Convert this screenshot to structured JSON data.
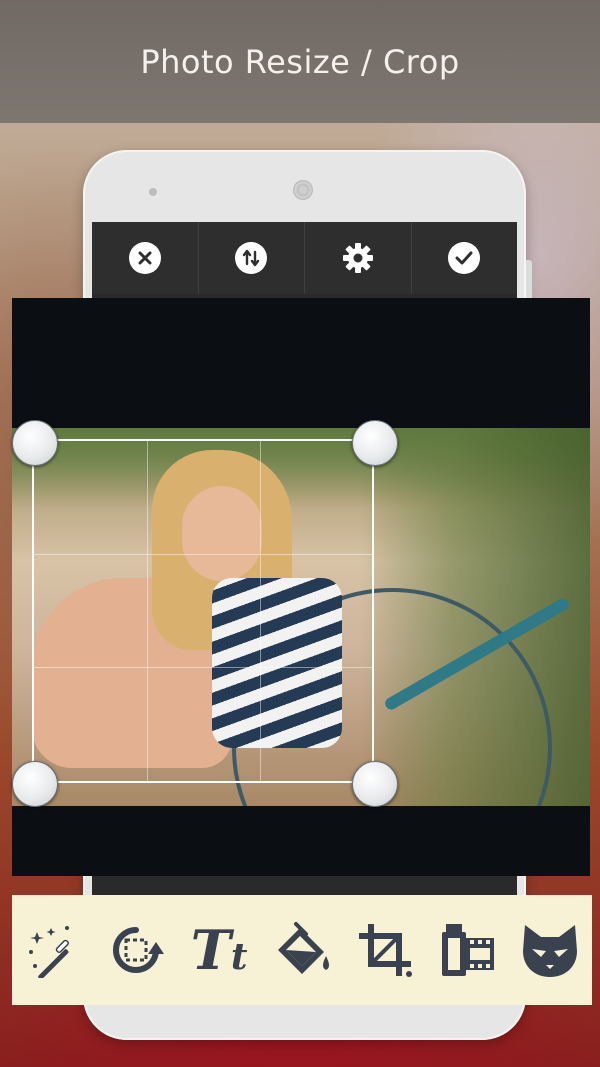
{
  "title": "Photo Resize / Crop",
  "colors": {
    "title_bar": "#747069",
    "toolbar_dark": "#2e2e2e",
    "bottom_toolbar": "#f7f1d5",
    "icon_dark": "#3a4250",
    "crop_background": "#0b0f13"
  },
  "top_toolbar": [
    {
      "name": "close-icon",
      "label": ""
    },
    {
      "name": "swap-icon",
      "label": ""
    },
    {
      "name": "gear-icon",
      "label": ""
    },
    {
      "name": "check-icon",
      "label": ""
    }
  ],
  "bottom_toolbar": {
    "text_tool_glyph_big": "T",
    "text_tool_glyph_small": "t",
    "icons": [
      "magic-wand-icon",
      "rotate-icon",
      "text-icon",
      "paint-bucket-icon",
      "crop-icon",
      "film-icon",
      "cat-mask-icon"
    ]
  },
  "crop": {
    "grid": "3x3",
    "handles": [
      "top-left",
      "top-right",
      "bottom-left",
      "bottom-right"
    ]
  }
}
